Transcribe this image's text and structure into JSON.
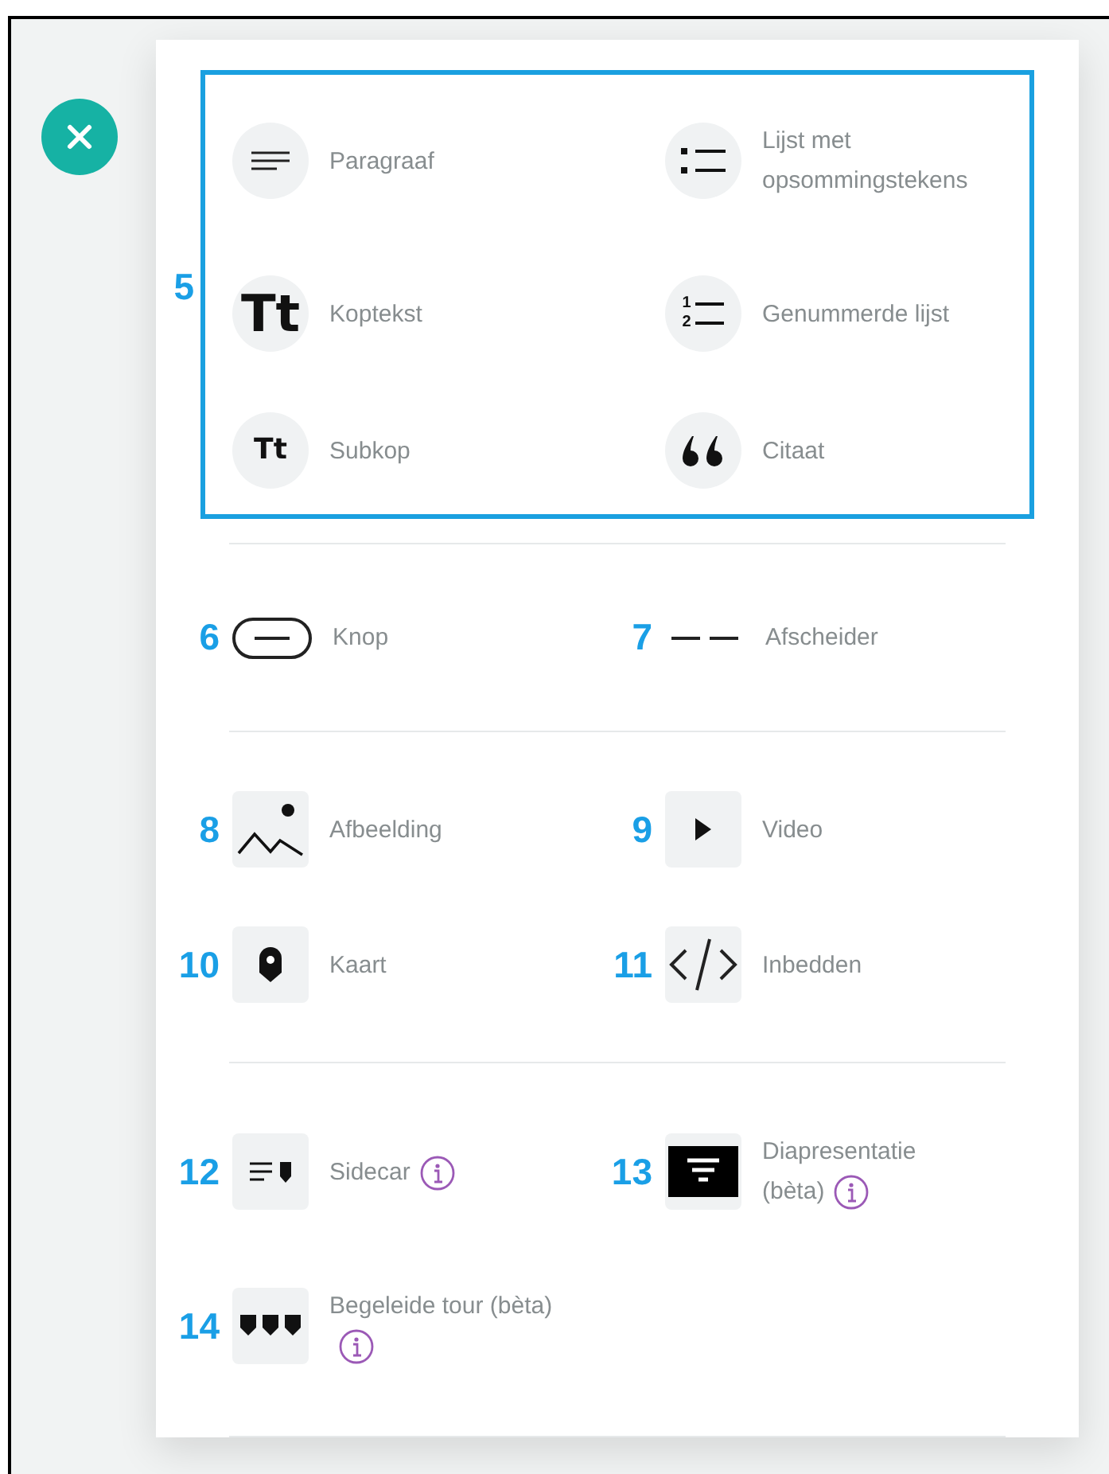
{
  "sections": [
    {
      "kind": "circle",
      "highlighted": true,
      "callout": "5",
      "items": [
        {
          "label": "Paragraaf"
        },
        {
          "label": "Lijst met opsommingstekens"
        },
        {
          "label": "Koptekst",
          "glyph": "Tt"
        },
        {
          "label": "Genummerde lijst",
          "glyphs": [
            "1",
            "2"
          ]
        },
        {
          "label": "Subkop",
          "glyph": "Tt"
        },
        {
          "label": "Citaat"
        }
      ]
    },
    {
      "kind": "plain",
      "highlighted": false,
      "items": [
        {
          "label": "Knop",
          "callout": "6"
        },
        {
          "label": "Afscheider",
          "callout": "7"
        }
      ]
    },
    {
      "kind": "square",
      "highlighted": false,
      "items": [
        {
          "label": "Afbeelding",
          "callout": "8"
        },
        {
          "label": "Video",
          "callout": "9"
        },
        {
          "label": "Kaart",
          "callout": "10"
        },
        {
          "label": "Inbedden",
          "callout": "11"
        }
      ]
    },
    {
      "kind": "square",
      "highlighted": false,
      "items": [
        {
          "label": "Sidecar",
          "callout": "12",
          "info": true
        },
        {
          "label": "Diapresentatie (bèta)",
          "callout": "13",
          "info": true
        },
        {
          "label": "Begeleide tour (bèta)",
          "callout": "14",
          "info": true
        }
      ]
    }
  ]
}
